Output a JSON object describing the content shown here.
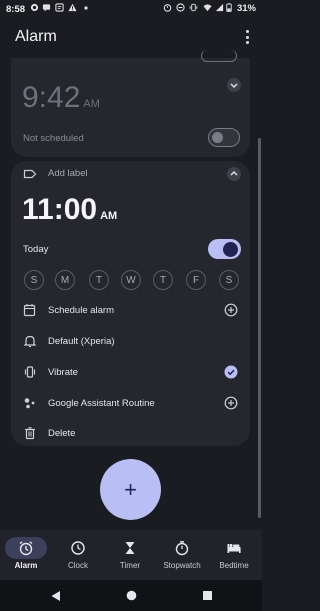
{
  "status_bar": {
    "time": "8:58",
    "battery": "31%"
  },
  "header": {
    "title": "Alarm"
  },
  "alarm1": {
    "time": "9:42",
    "ampm": "AM",
    "schedule": "Not scheduled",
    "enabled": false
  },
  "alarm2": {
    "add_label": "Add label",
    "time": "11:00",
    "ampm": "AM",
    "day_text": "Today",
    "enabled": true,
    "days": [
      "S",
      "M",
      "T",
      "W",
      "T",
      "F",
      "S"
    ],
    "rows": {
      "schedule": "Schedule alarm",
      "ringtone": "Default (Xperia)",
      "vibrate": "Vibrate",
      "assistant": "Google Assistant Routine",
      "delete": "Delete"
    },
    "vibrate_checked": true
  },
  "fab": {
    "icon": "plus-icon",
    "glyph": "+"
  },
  "bottom_nav": {
    "items": [
      {
        "label": "Alarm",
        "icon": "alarm-icon",
        "active": true
      },
      {
        "label": "Clock",
        "icon": "clock-icon",
        "active": false
      },
      {
        "label": "Timer",
        "icon": "hourglass-icon",
        "active": false
      },
      {
        "label": "Stopwatch",
        "icon": "stopwatch-icon",
        "active": false
      },
      {
        "label": "Bedtime",
        "icon": "bed-icon",
        "active": false
      }
    ]
  },
  "colors": {
    "accent": "#b9bef5",
    "background": "#1b1c22",
    "card": "#25262e"
  }
}
